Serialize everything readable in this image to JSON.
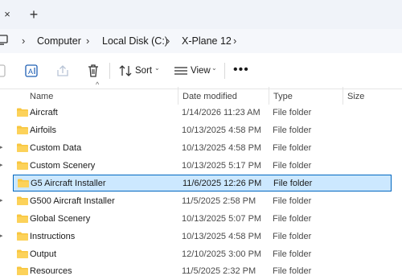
{
  "tabs": {
    "close_glyph": "×",
    "new_tab_glyph": "+"
  },
  "address": {
    "icon": "monitor-icon",
    "crumbs": [
      "Computer",
      "Local Disk (C:)",
      "X-Plane 12"
    ]
  },
  "toolbar": {
    "sort_label": "Sort",
    "view_label": "View",
    "more_glyph": "•••"
  },
  "columns": {
    "name": "Name",
    "date": "Date modified",
    "type": "Type",
    "size": "Size"
  },
  "rows": [
    {
      "name": "Aircraft",
      "date": "1/14/2026 11:23 AM",
      "type": "File folder"
    },
    {
      "name": "Airfoils",
      "date": "10/13/2025 4:58 PM",
      "type": "File folder"
    },
    {
      "name": "Custom Data",
      "date": "10/13/2025 4:58 PM",
      "type": "File folder"
    },
    {
      "name": "Custom Scenery",
      "date": "10/13/2025 5:17 PM",
      "type": "File folder"
    },
    {
      "name": "G5 Aircraft Installer",
      "date": "11/6/2025 12:26 PM",
      "type": "File folder",
      "selected": true
    },
    {
      "name": "G500 Aircraft Installer",
      "date": "11/5/2025 2:58 PM",
      "type": "File folder"
    },
    {
      "name": "Global Scenery",
      "date": "10/13/2025 5:07 PM",
      "type": "File folder"
    },
    {
      "name": "Instructions",
      "date": "10/13/2025 4:58 PM",
      "type": "File folder"
    },
    {
      "name": "Output",
      "date": "12/10/2025 3:00 PM",
      "type": "File folder"
    },
    {
      "name": "Resources",
      "date": "11/5/2025 2:32 PM",
      "type": "File folder"
    }
  ],
  "colors": {
    "selection_bg": "#cce8ff",
    "selection_border": "#0067c0",
    "folder": "#f8c63f"
  }
}
